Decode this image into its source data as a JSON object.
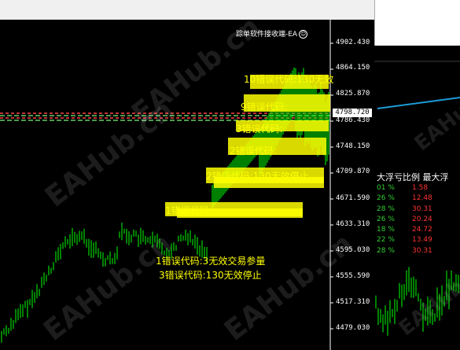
{
  "ea_label": "踪单软件接收端-EA",
  "ea_face": "☺",
  "current_price": "4798.720",
  "price_axis": [
    "4902.430",
    "4864.150",
    "4825.870",
    "4786.430",
    "4748.150",
    "4709.870",
    "4671.590",
    "4633.310",
    "4595.030",
    "4555.590",
    "4517.310",
    "4479.030"
  ],
  "errors": {
    "line1": "1错误代码:3无效交易参量",
    "line2": "3错误代码:130无效停止"
  },
  "cluster_texts": [
    "10错误代码:130无效",
    "9错误代码:",
    "3错误代码:",
    "2错误代码:",
    "2错误代码:130无效停止",
    "1错误代码:"
  ],
  "watermark": "EAHub.cn",
  "panel": {
    "header": "大浮亏比例  最大浮",
    "rows": [
      {
        "pct": "01 %",
        "val": "1.58"
      },
      {
        "pct": "26 %",
        "val": "12.48"
      },
      {
        "pct": "28 %",
        "val": "30.31"
      },
      {
        "pct": "26 %",
        "val": "20.24"
      },
      {
        "pct": "18 %",
        "val": "24.72"
      },
      {
        "pct": "22 %",
        "val": "13.49"
      },
      {
        "pct": "28 %",
        "val": "30.31"
      }
    ]
  },
  "colors": {
    "candle": "#00ff00",
    "error_text": "#ffff00",
    "level_line": "#ff4444",
    "level_line_alt": "#66cc66",
    "indicator_line": "#1e9bd7"
  }
}
